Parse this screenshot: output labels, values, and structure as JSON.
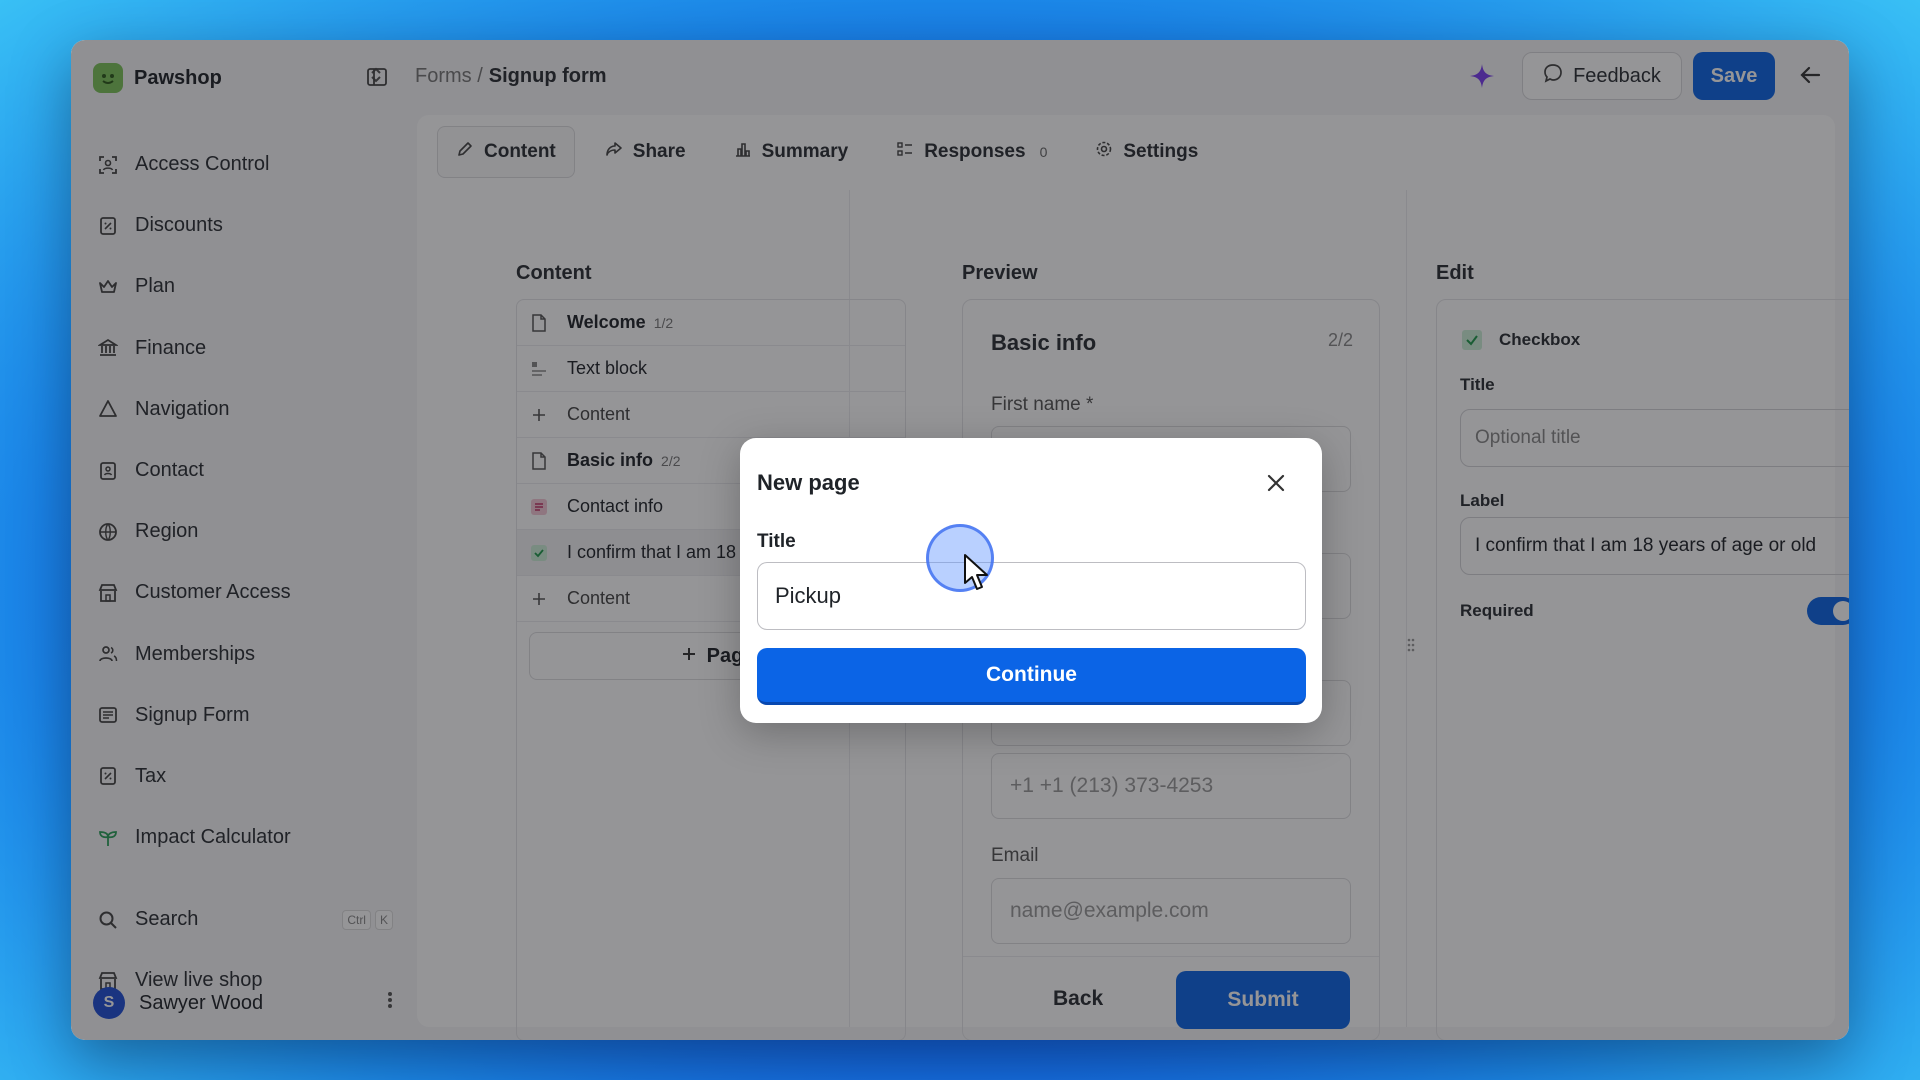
{
  "app": {
    "name": "Pawshop"
  },
  "sidebar": {
    "items": [
      {
        "label": "Access Control",
        "icon": "access-control-icon"
      },
      {
        "label": "Discounts",
        "icon": "discount-icon"
      },
      {
        "label": "Plan",
        "icon": "crown-icon"
      },
      {
        "label": "Finance",
        "icon": "bank-icon"
      },
      {
        "label": "Navigation",
        "icon": "navigation-icon"
      },
      {
        "label": "Contact",
        "icon": "contact-icon"
      },
      {
        "label": "Region",
        "icon": "globe-icon"
      },
      {
        "label": "Customer Access",
        "icon": "store-icon"
      },
      {
        "label": "Memberships",
        "icon": "users-icon"
      },
      {
        "label": "Signup Form",
        "icon": "form-icon"
      },
      {
        "label": "Tax",
        "icon": "tax-icon"
      },
      {
        "label": "Impact Calculator",
        "icon": "sprout-icon"
      }
    ],
    "search": {
      "label": "Search",
      "shortcut_1": "Ctrl",
      "shortcut_2": "K"
    },
    "live_shop": "View live shop",
    "user": {
      "initial": "S",
      "name": "Sawyer Wood"
    }
  },
  "header": {
    "breadcrumb_parent": "Forms /",
    "breadcrumb_current": "Signup form",
    "feedback_label": "Feedback",
    "save_label": "Save"
  },
  "tabs": [
    {
      "label": "Content",
      "active": true
    },
    {
      "label": "Share"
    },
    {
      "label": "Summary"
    },
    {
      "label": "Responses",
      "count": "0"
    },
    {
      "label": "Settings"
    }
  ],
  "content": {
    "title": "Content",
    "rows": [
      {
        "label": "Welcome",
        "frac": "1/2"
      },
      {
        "label": "Text block"
      },
      {
        "label": "Content"
      },
      {
        "label": "Basic info",
        "frac": "2/2"
      },
      {
        "label": "Contact info"
      },
      {
        "label": "I confirm that I am 18"
      },
      {
        "label": "Content"
      }
    ],
    "add_page": "Pag"
  },
  "preview": {
    "title": "Preview",
    "page_title": "Basic info",
    "page_num": "2/2",
    "first_name_label": "First name *",
    "phone_placeholder": "+1  +1 (213) 373-4253",
    "email_label": "Email",
    "email_placeholder": "name@example.com",
    "back_label": "Back",
    "submit_label": "Submit"
  },
  "edit": {
    "title": "Edit",
    "block_type": "Checkbox",
    "title_label": "Title",
    "title_placeholder": "Optional title",
    "label_label": "Label",
    "label_value": "I confirm that I am 18 years of age or old",
    "required_label": "Required",
    "required": true
  },
  "modal": {
    "title": "New page",
    "field_label": "Title",
    "field_value": "Pickup",
    "continue_label": "Continue"
  },
  "colors": {
    "accent": "#0b64e6",
    "brand": "#7cc35a"
  }
}
